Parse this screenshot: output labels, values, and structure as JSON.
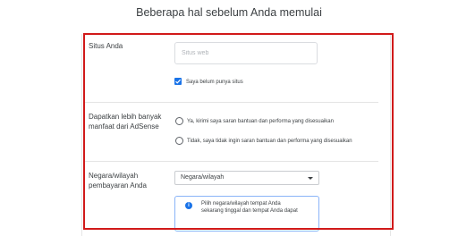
{
  "page": {
    "heading": "Beberapa hal sebelum Anda memulai"
  },
  "site": {
    "label": "Situs Anda",
    "input_placeholder": "Situs web",
    "no_site_checkbox": {
      "label": "Saya belum punya situs",
      "checked": true
    }
  },
  "personalized_help": {
    "label_line1": "Dapatkan lebih banyak",
    "label_line2": "manfaat dari AdSense",
    "options": [
      "Ya, kirimi saya saran bantuan dan performa yang disesuaikan",
      "Tidak, saya tidak ingin saran bantuan dan performa yang disesuaikan"
    ]
  },
  "country": {
    "label_line1": "Negara/wilayah",
    "label_line2": "pembayaran Anda",
    "select_value": "Negara/wilayah",
    "info_line1": "Pilih negara/wilayah tempat Anda",
    "info_line2": "sekarang tinggal dan tempat Anda dapat"
  },
  "colors": {
    "accent": "#1a73e8",
    "highlight_border": "#d11a1a"
  }
}
